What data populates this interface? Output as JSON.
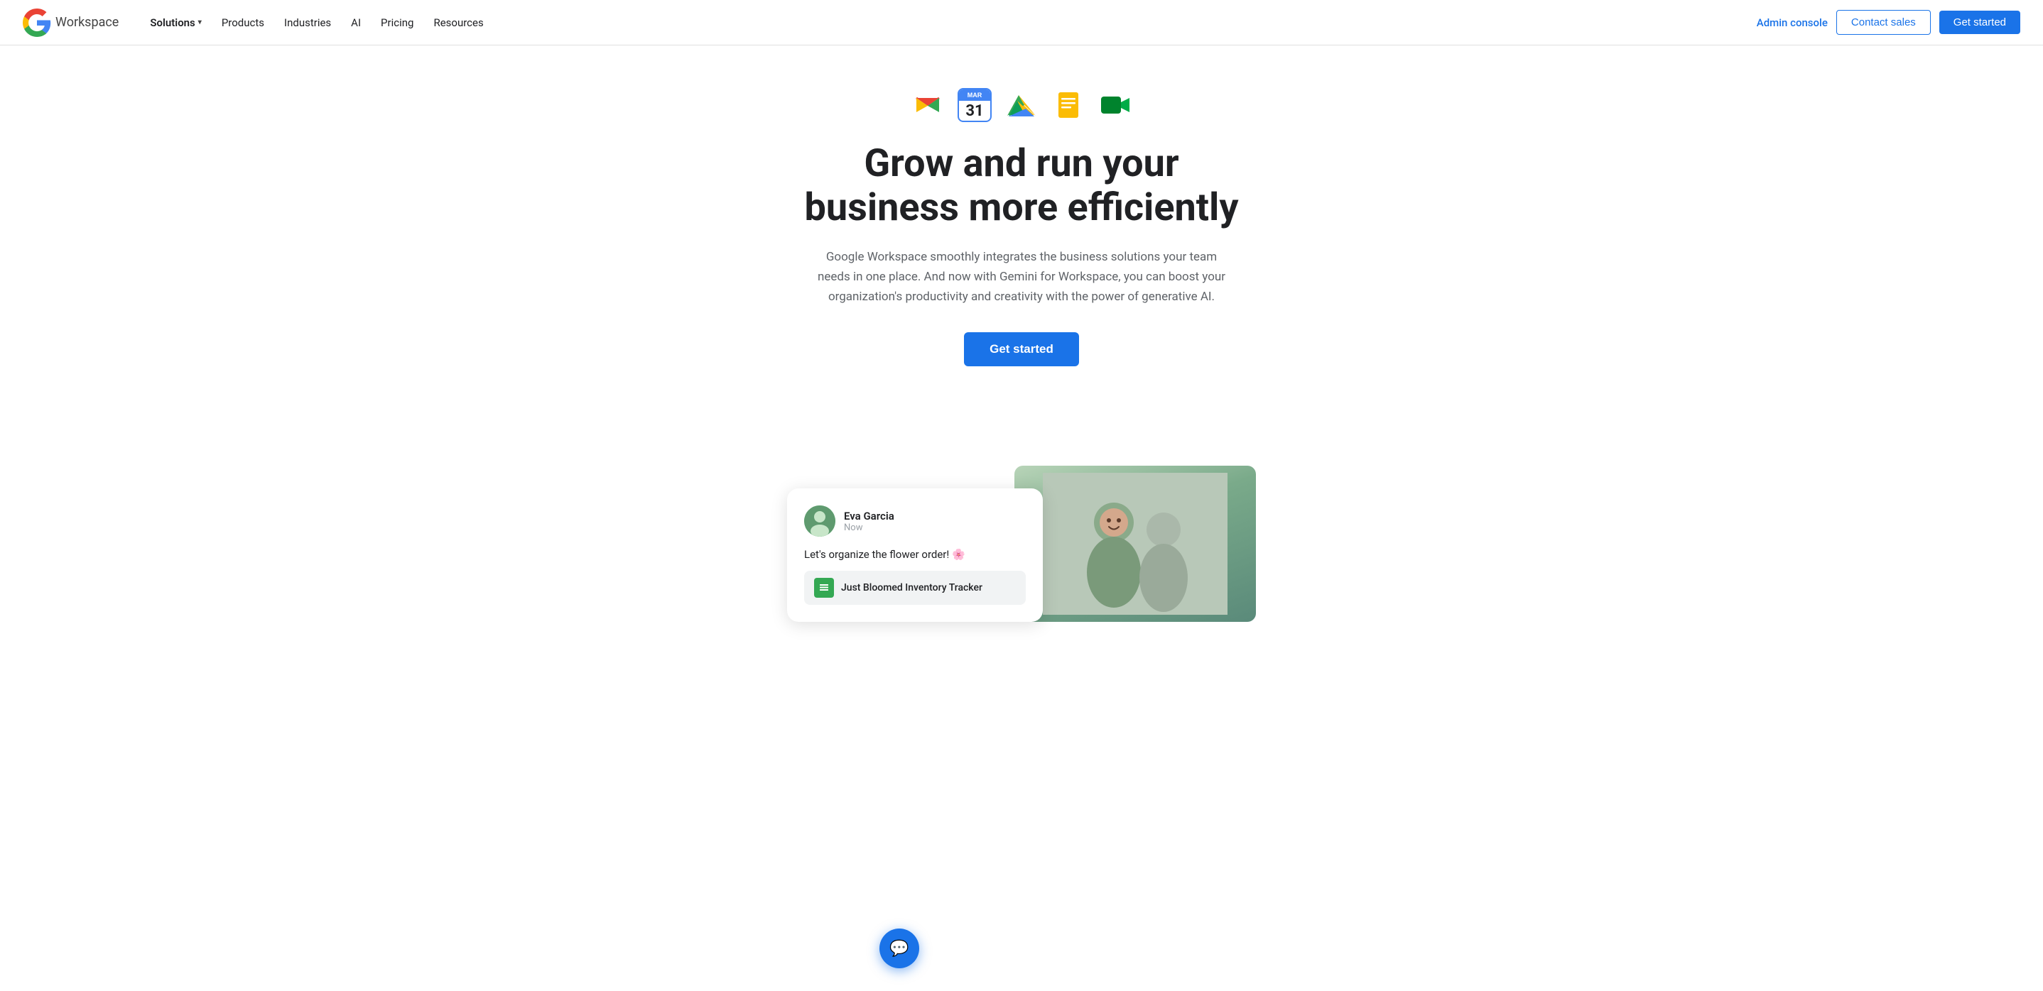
{
  "brand": {
    "google": "Google",
    "workspace": "Workspace",
    "logo_g": "G",
    "logo_colors": {
      "blue": "#4285F4",
      "red": "#EA4335",
      "yellow": "#FBBC05",
      "green": "#34A853"
    }
  },
  "nav": {
    "solutions_label": "Solutions",
    "products_label": "Products",
    "industries_label": "Industries",
    "ai_label": "AI",
    "pricing_label": "Pricing",
    "resources_label": "Resources",
    "admin_label": "Admin console",
    "contact_label": "Contact sales",
    "get_started_label": "Get started"
  },
  "hero": {
    "title_line1": "Grow and run your",
    "title_line2": "business more efficiently",
    "subtitle": "Google Workspace smoothly integrates the business solutions your team needs in one place. And now with Gemini for Workspace, you can boost your organization's productivity and creativity with the power of generative AI.",
    "cta_label": "Get started"
  },
  "icons": {
    "gmail": "M",
    "calendar_month": "MAR",
    "calendar_day": "31",
    "drive_label": "Drive",
    "docs_label": "Docs",
    "meet_label": "Meet"
  },
  "chat_preview": {
    "sender_name": "Eva Garcia",
    "time": "Now",
    "message": "Let's organize the flower order! 🌸",
    "attachment_name": "Just Bloomed Inventory Tracker"
  },
  "chat_fab": {
    "icon": "💬"
  }
}
